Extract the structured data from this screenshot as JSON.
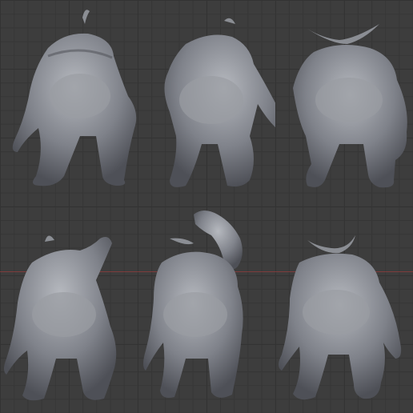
{
  "viewport": {
    "background_color": "#3d3d3d",
    "grid_color": "#333333",
    "x_axis_color": "#8a3b3b",
    "model_color": "#8b8e94"
  },
  "poses": [
    {
      "view": "back",
      "variant": 1
    },
    {
      "view": "back-right",
      "variant": 2
    },
    {
      "view": "back-twisted",
      "variant": 3
    },
    {
      "view": "back-arm-raised",
      "variant": 4
    },
    {
      "view": "back-arm-raised-high",
      "variant": 5
    },
    {
      "view": "back-horns",
      "variant": 6
    }
  ]
}
